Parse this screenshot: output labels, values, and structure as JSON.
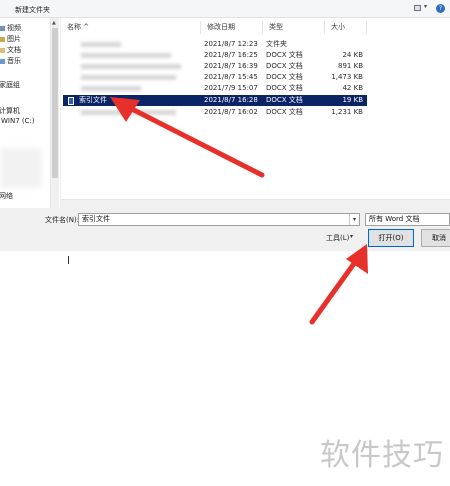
{
  "toolbar": {
    "new_folder": "新建文件夹",
    "help": "?"
  },
  "nav": {
    "items": [
      {
        "label": "视频",
        "icon": "video-folder-icon"
      },
      {
        "label": "图片",
        "icon": "pictures-folder-icon"
      },
      {
        "label": "文档",
        "icon": "documents-folder-icon"
      },
      {
        "label": "音乐",
        "icon": "music-folder-icon"
      },
      {
        "label": "家庭组",
        "icon": "homegroup-icon"
      },
      {
        "label": "计算机",
        "icon": "computer-icon"
      },
      {
        "label": "WIN7 (C:)",
        "icon": "drive-icon"
      },
      {
        "label": "网络",
        "icon": "network-icon"
      }
    ]
  },
  "filelist": {
    "columns": {
      "name": "名称",
      "modified": "修改日期",
      "type": "类型",
      "size": "大小"
    },
    "rows": [
      {
        "name": "",
        "modified": "2021/8/7 12:23",
        "type": "文件夹",
        "size": ""
      },
      {
        "name": "",
        "modified": "2021/8/7 16:25",
        "type": "DOCX 文档",
        "size": "24 KB"
      },
      {
        "name": "",
        "modified": "2021/8/7 16:39",
        "type": "DOCX 文档",
        "size": "891 KB"
      },
      {
        "name": "",
        "modified": "2021/8/7 15:45",
        "type": "DOCX 文档",
        "size": "1,473 KB"
      },
      {
        "name": "",
        "modified": "2021/7/9 15:07",
        "type": "DOCX 文档",
        "size": "42 KB"
      },
      {
        "name": "索引文件",
        "modified": "2021/8/7 16:28",
        "type": "DOCX 文档",
        "size": "19 KB",
        "selected": true
      },
      {
        "name": "",
        "modified": "2021/8/7 16:02",
        "type": "DOCX 文档",
        "size": "1,231 KB"
      }
    ]
  },
  "bottom": {
    "filename_label": "文件名(N):",
    "filename_value": "索引文件",
    "filetype_value": "所有 Word 文档",
    "tools_label": "工具(L)",
    "open_label": "打开(O)",
    "cancel_label": "取消"
  },
  "watermark": "软件技巧",
  "colors": {
    "selection": "#0a2466",
    "arrow": "#e8302a",
    "open_border": "#0a64c8"
  }
}
